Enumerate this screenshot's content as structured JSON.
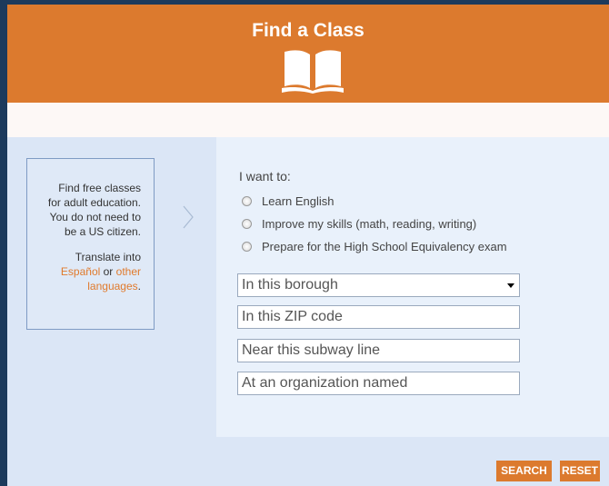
{
  "header": {
    "title": "Find a Class"
  },
  "info": {
    "line1": "Find free classes",
    "line2": "for adult education.",
    "line3": "You do not need to",
    "line4": "be a US citizen.",
    "translate_prefix": "Translate into",
    "espanol_link": "Español",
    "or": " or ",
    "other_link": "other",
    "languages_link": "languages",
    "period": "."
  },
  "form": {
    "want_label": "I want to:",
    "options": [
      {
        "label": "Learn English",
        "selected": false
      },
      {
        "label": "Improve my skills (math, reading, writing)",
        "selected": false
      },
      {
        "label": "Prepare for the High School Equivalency exam",
        "selected": false
      }
    ],
    "borough_select": "In this borough",
    "zip_placeholder": "In this ZIP code",
    "subway_placeholder": "Near this subway line",
    "org_placeholder": "At an organization named"
  },
  "buttons": {
    "search": "SEARCH",
    "reset": "RESET"
  },
  "colors": {
    "accent": "#dc7a2e",
    "page_bg": "#1c3a5c",
    "panel": "#dbe6f6",
    "form_panel": "#e9f1fb"
  }
}
